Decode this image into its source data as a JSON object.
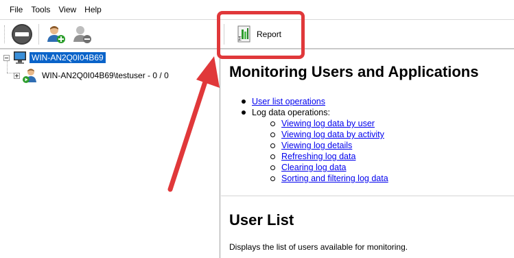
{
  "menu": [
    "File",
    "Tools",
    "View",
    "Help"
  ],
  "toolbar": {
    "report_label": "Report"
  },
  "tree": {
    "root_label": "WIN-AN2Q0I04B69",
    "child_label": "WIN-AN2Q0I04B69\\testuser - 0 / 0"
  },
  "content": {
    "title": "Monitoring Users and Applications",
    "bullets": {
      "user_list_ops": "User list operations",
      "log_ops": "Log data operations:"
    },
    "sub_links": [
      "Viewing log data by user",
      "Viewing log data by activity",
      "Viewing log details",
      "Refreshing log data",
      "Clearing log data",
      "Sorting and filtering log data"
    ],
    "user_list_heading": "User List",
    "user_list_desc": "Displays the list of users available for monitoring."
  },
  "colors": {
    "highlight": "#e0383a",
    "selection": "#0a63c9",
    "link": "#0000ee"
  }
}
